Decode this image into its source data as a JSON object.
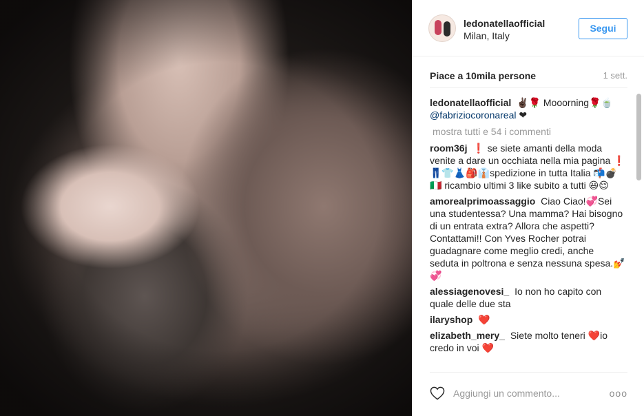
{
  "post": {
    "username": "ledonatellaofficial",
    "location": "Milan, Italy",
    "follow_label": "Segui",
    "likes_text": "Piace a 10mila persone",
    "time_text": "1 sett.",
    "caption": {
      "user": "ledonatellaofficial",
      "text": "✌🏿🌹 Mooorning🌹🍵",
      "mention": "@fabriziocoronareal",
      "suffix": "❤"
    },
    "show_all_text": "mostra tutti e 54 i commenti",
    "comments": [
      {
        "user": "room36j",
        "text": "❗ se siete amanti della moda venite a dare un occhiata nella mia pagina ❗👖👕👗🎒👔spedizione in tutta Italia 📬💣🇮🇹 ricambio ultimi 3 like subito a tutti 😃😌"
      },
      {
        "user": "amorealprimoassaggio",
        "text": "Ciao Ciao!💞Sei una studentessa? Una mamma? Hai bisogno di un entrata extra? Allora che aspetti? Contattami!! Con Yves Rocher potrai guadagnare come meglio credi, anche seduta in poltrona e senza nessuna spesa.💅💞"
      },
      {
        "user": "alessiagenovesi_",
        "text": "Io non ho capito con quale delle due sta"
      },
      {
        "user": "ilaryshop",
        "text": "❤️"
      },
      {
        "user": "elizabeth_mery_",
        "text": "Siete molto teneri ❤️io credo in voi ❤️"
      }
    ],
    "comment_placeholder": "Aggiungi un commento...",
    "more_label": "ooo"
  },
  "icons": {
    "heart": "heart-outline-icon",
    "more": "more-options-icon"
  },
  "colors": {
    "accent": "#3897f0",
    "border": "#efefef",
    "muted": "#999999",
    "mention": "#003569"
  }
}
